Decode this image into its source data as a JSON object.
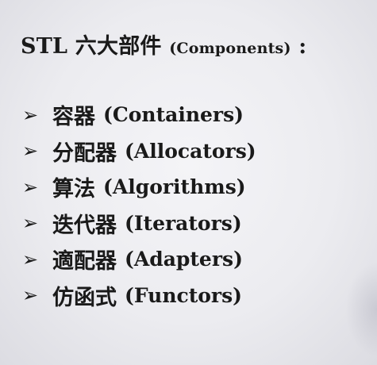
{
  "title": {
    "prefix": "STL",
    "cjk": "六大部件",
    "sub": "(Components)",
    "suffix": ":"
  },
  "bullet_glyph": "➢",
  "items": [
    {
      "zh": "容器",
      "en": "(Containers)"
    },
    {
      "zh": "分配器",
      "en": "(Allocators)"
    },
    {
      "zh": "算法",
      "en": "(Algorithms)"
    },
    {
      "zh": "迭代器",
      "en": "(Iterators)"
    },
    {
      "zh": "適配器",
      "en": "(Adapters)"
    },
    {
      "zh": "仿函式",
      "en": "(Functors)"
    }
  ]
}
